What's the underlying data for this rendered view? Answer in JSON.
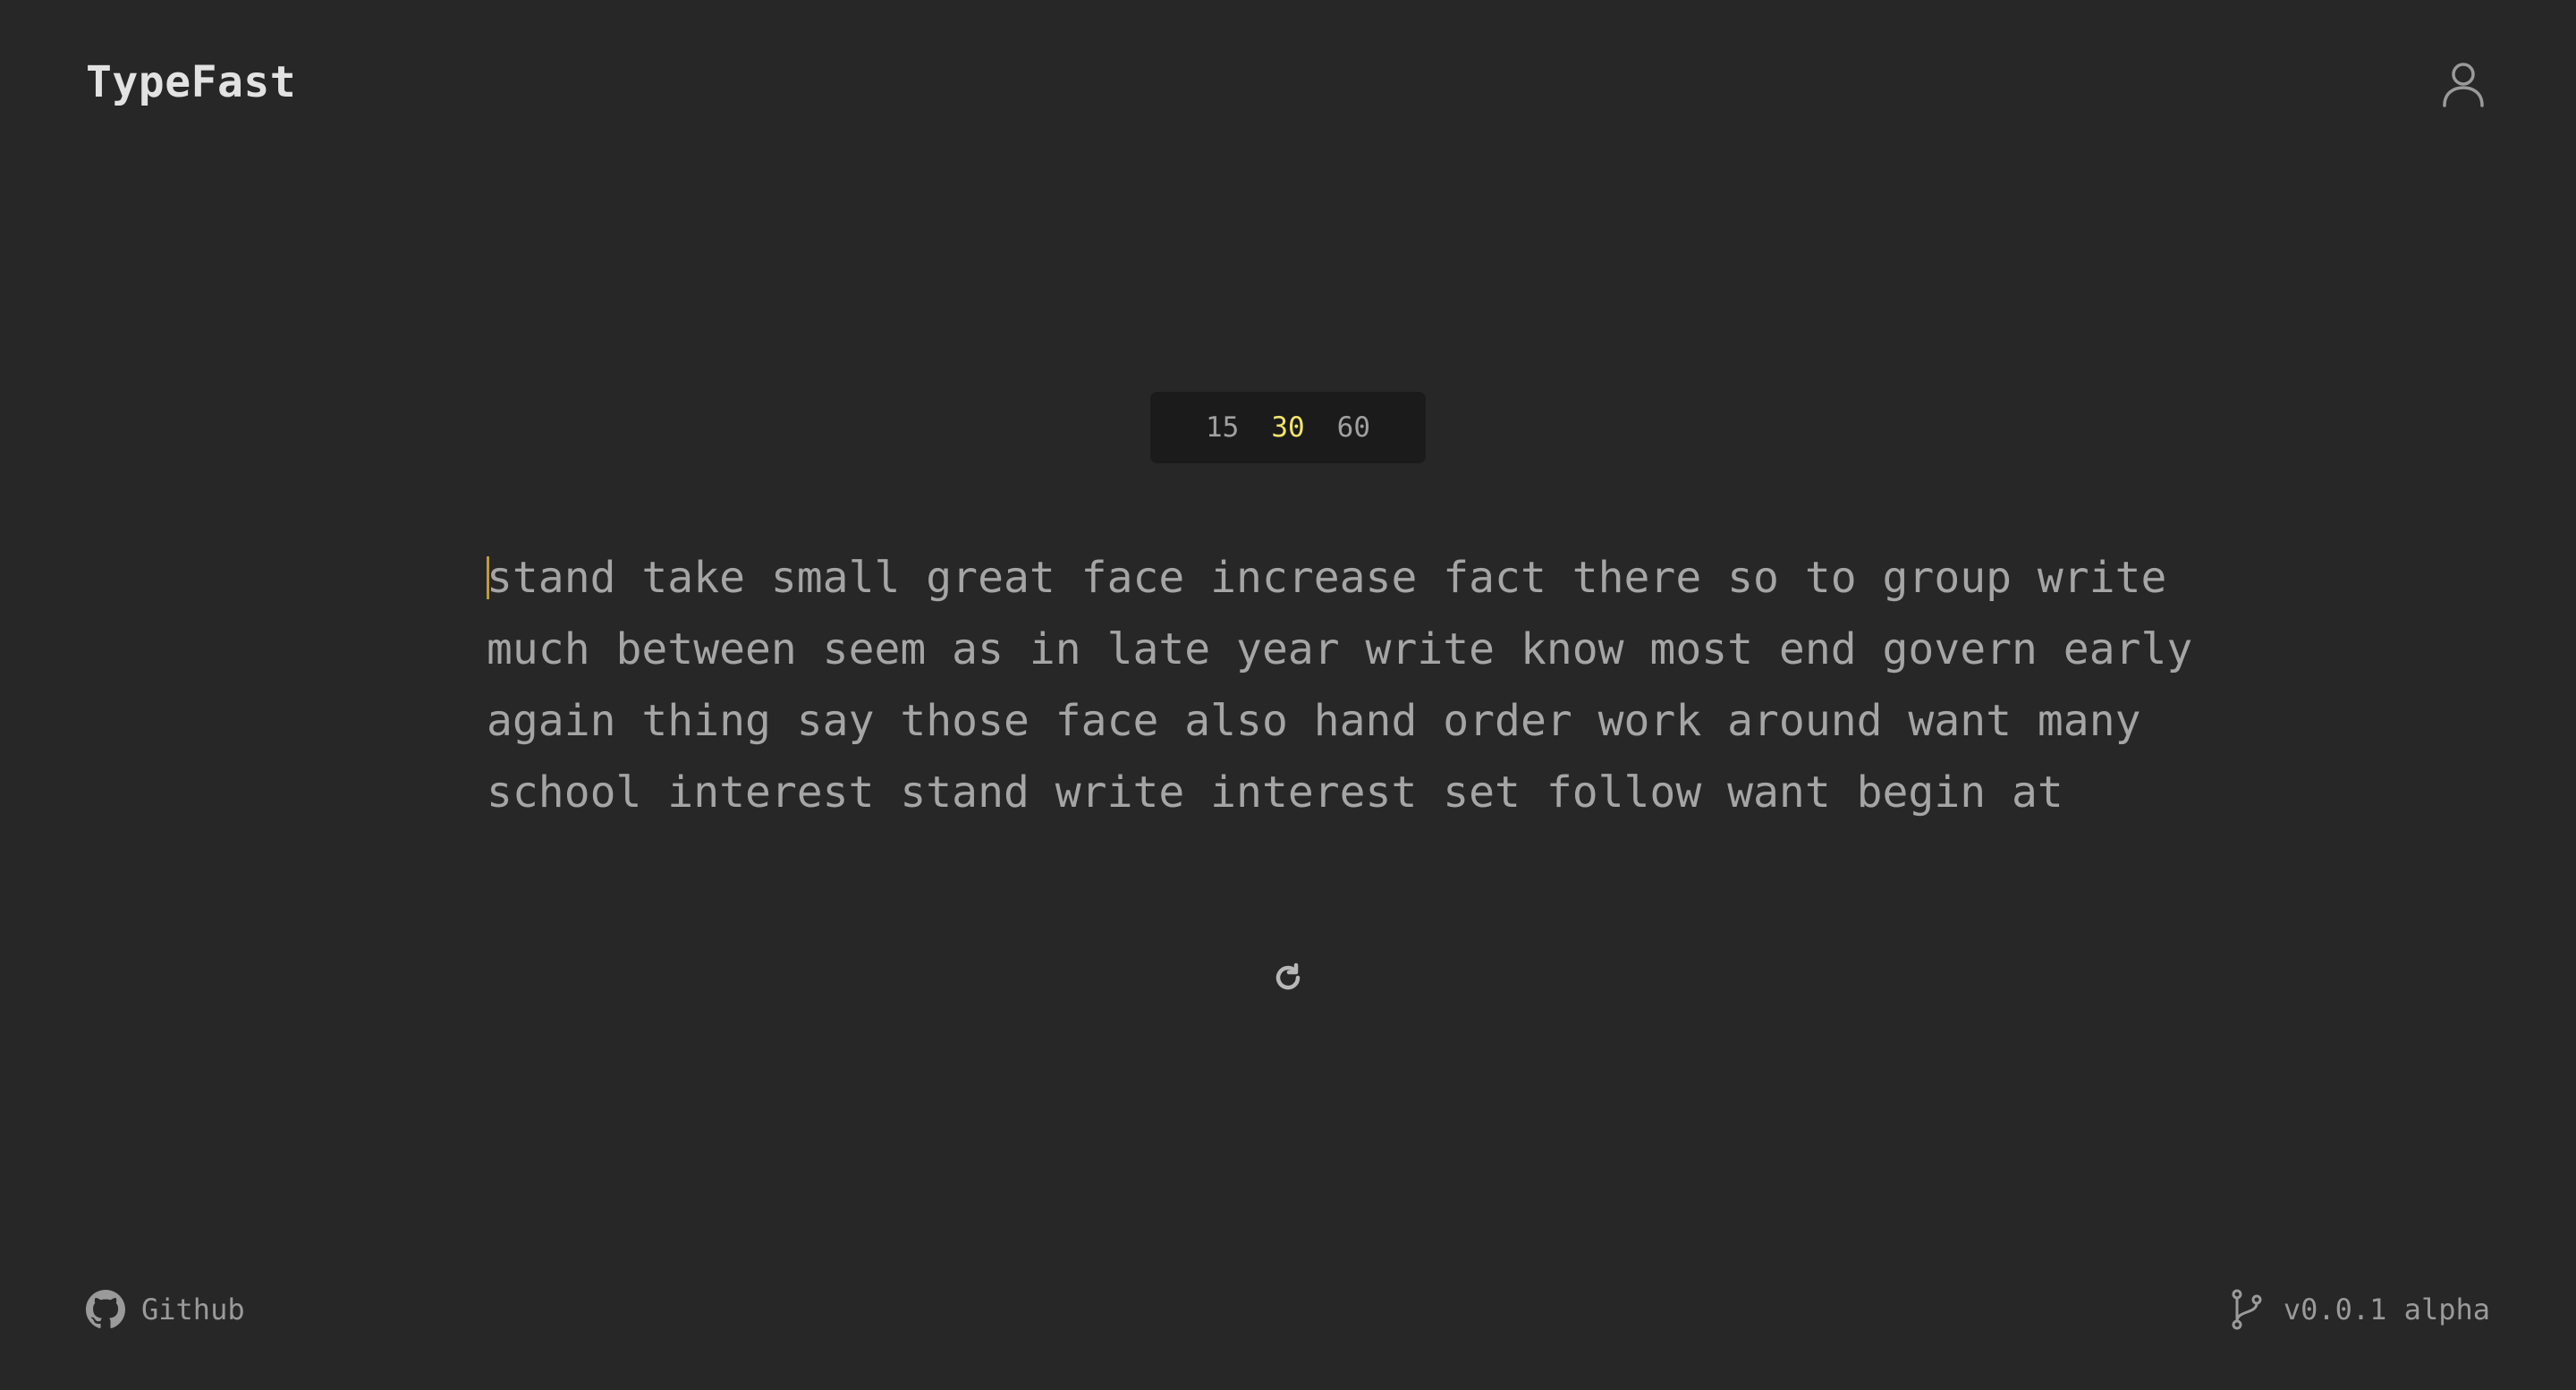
{
  "app": {
    "title": "TypeFast"
  },
  "header": {
    "user_icon": "user-icon"
  },
  "timer": {
    "options": [
      "15",
      "30",
      "60"
    ],
    "selected": "30"
  },
  "words": {
    "lines": [
      "stand take small great face increase fact there so to group write",
      "much between seem as in late year write know most end govern early",
      "again thing say those face also hand order work around want many",
      "school interest stand write interest set follow want begin at"
    ]
  },
  "restart": {
    "icon": "restart-icon"
  },
  "footer": {
    "github_label": "Github",
    "github_icon": "github-icon",
    "version_label": "v0.0.1 alpha",
    "version_icon": "git-branch-icon"
  },
  "colors": {
    "background": "#272727",
    "timer_bg": "#1b1b1b",
    "accent": "#f2e36a",
    "caret": "#b99b3b",
    "text": "#a5a5a5"
  }
}
